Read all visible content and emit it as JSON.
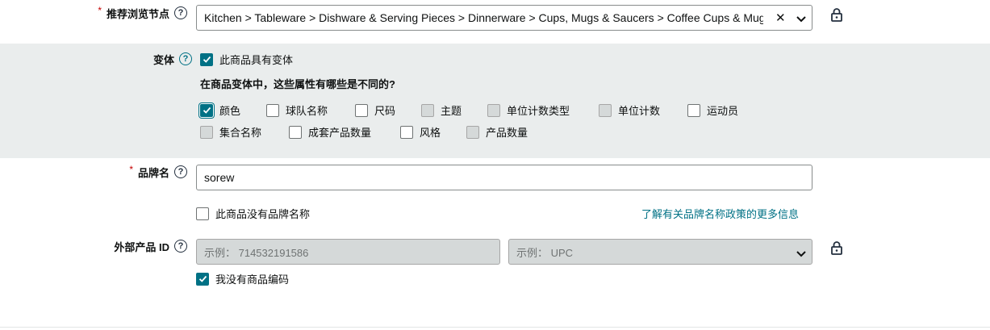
{
  "browse_node": {
    "required_mark": "*",
    "label": "推荐浏览节点",
    "help_icon": "?",
    "value": "Kitchen > Tableware > Dishware & Serving Pieces > Dinnerware > Cups, Mugs & Saucers > Coffee Cups & Mugs",
    "clear_icon": "✕",
    "dropdown_icon": "chevron-down-icon",
    "lock_icon": "lock-icon"
  },
  "variation": {
    "label": "变体",
    "help_icon": "?",
    "has_variations_label": "此商品具有变体",
    "has_variations_checked": true,
    "question": "在商品变体中，这些属性有哪些是不同的?",
    "attributes": [
      {
        "label": "颜色",
        "checked": true,
        "disabled": false
      },
      {
        "label": "球队名称",
        "checked": false,
        "disabled": false
      },
      {
        "label": "尺码",
        "checked": false,
        "disabled": false
      },
      {
        "label": "主题",
        "checked": false,
        "disabled": true
      },
      {
        "label": "单位计数类型",
        "checked": false,
        "disabled": true
      },
      {
        "label": "单位计数",
        "checked": false,
        "disabled": true
      },
      {
        "label": "运动员",
        "checked": false,
        "disabled": false
      },
      {
        "label": "集合名称",
        "checked": false,
        "disabled": true
      },
      {
        "label": "成套产品数量",
        "checked": false,
        "disabled": false
      },
      {
        "label": "风格",
        "checked": false,
        "disabled": false
      },
      {
        "label": "产品数量",
        "checked": false,
        "disabled": true
      }
    ]
  },
  "brand": {
    "required_mark": "*",
    "label": "品牌名",
    "help_icon": "?",
    "value": "sorew",
    "no_brand_label": "此商品没有品牌名称",
    "no_brand_checked": false,
    "policy_link": "了解有关品牌名称政策的更多信息"
  },
  "external_id": {
    "label": "外部产品 ID",
    "help_icon": "?",
    "id_placeholder": "示例： 714532191586",
    "type_placeholder": "示例： UPC",
    "dropdown_icon": "chevron-down-icon",
    "lock_icon": "lock-icon",
    "no_code_label": "我没有商品编码",
    "no_code_checked": true
  },
  "colors": {
    "accent": "#007185",
    "required": "#c40000",
    "band": "#eaeded",
    "disabled_field": "#d5d9d9"
  }
}
